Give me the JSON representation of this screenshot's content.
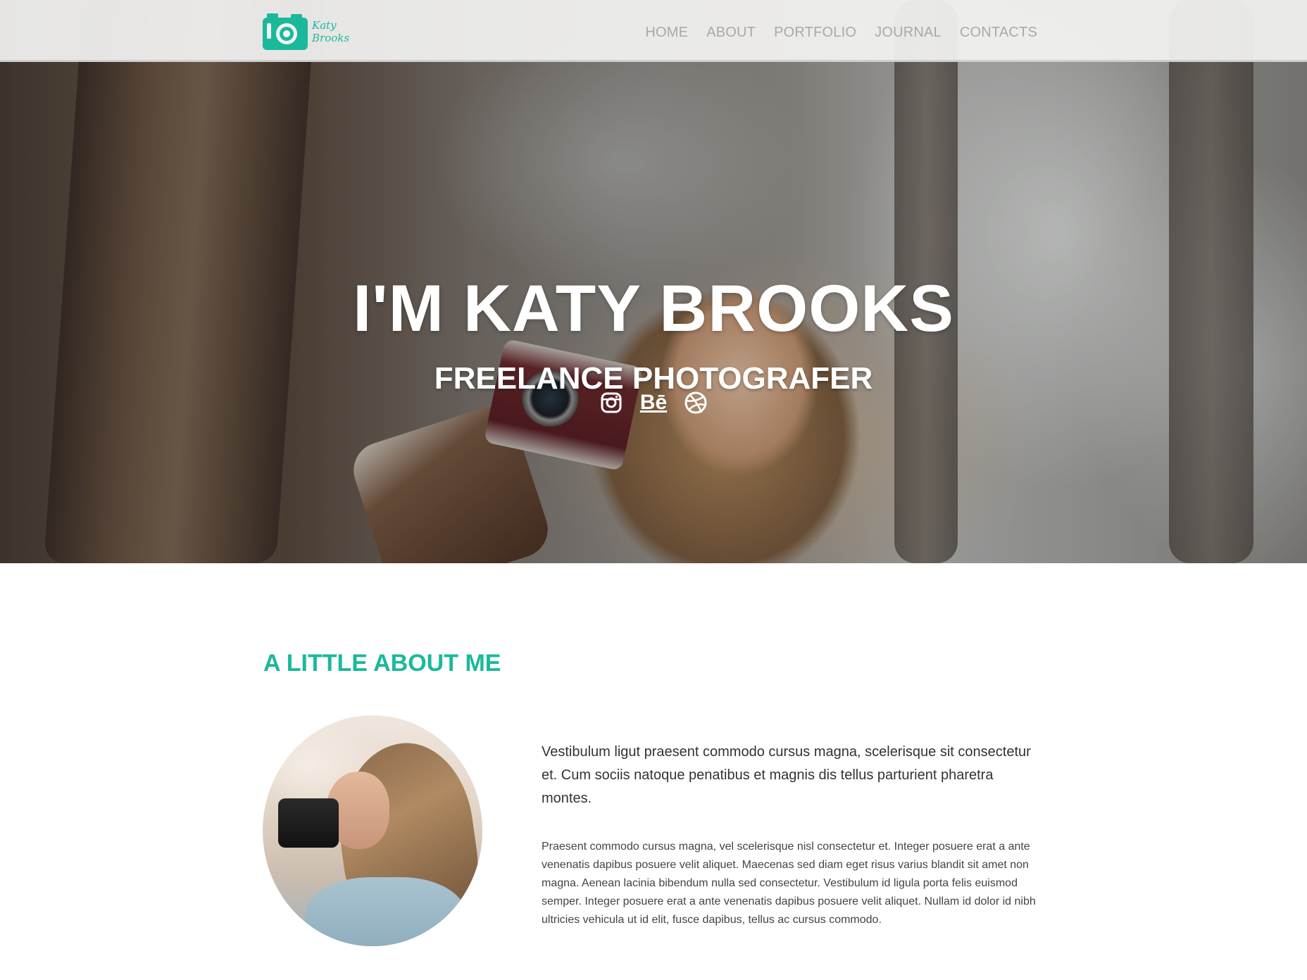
{
  "brand": {
    "logo_text_line1": "Katy",
    "logo_text_line2": "Brooks",
    "accent_color": "#1ab99c"
  },
  "nav": {
    "items": [
      {
        "label": "HOME"
      },
      {
        "label": "ABOUT"
      },
      {
        "label": "PORTFOLIO"
      },
      {
        "label": "JOURNAL"
      },
      {
        "label": "CONTACTS"
      }
    ]
  },
  "hero": {
    "title": "I'M KATY BROOKS",
    "subtitle": "FREELANCE PHOTOGRAFER",
    "socials": {
      "instagram_icon": "instagram-icon",
      "behance_label": "Bē",
      "dribbble_icon": "dribbble-icon"
    }
  },
  "about": {
    "title": "A LITTLE ABOUT ME",
    "lead": "Vestibulum ligut praesent commodo cursus magna, scelerisque sit consectetur et. Cum sociis natoque penatibus et magnis dis tellus parturient pharetra montes.",
    "body": "Praesent commodo cursus magna, vel scelerisque nisl consectetur et. Integer posuere erat a ante venenatis dapibus posuere velit aliquet. Maecenas sed diam eget risus varius blandit sit amet non magna. Aenean lacinia bibendum nulla sed consectetur. Vestibulum id ligula porta felis euismod semper. Integer posuere erat a ante venenatis dapibus posuere velit aliquet. Nullam id dolor id nibh ultricies vehicula ut id elit, fusce dapibus, tellus ac cursus commodo."
  }
}
